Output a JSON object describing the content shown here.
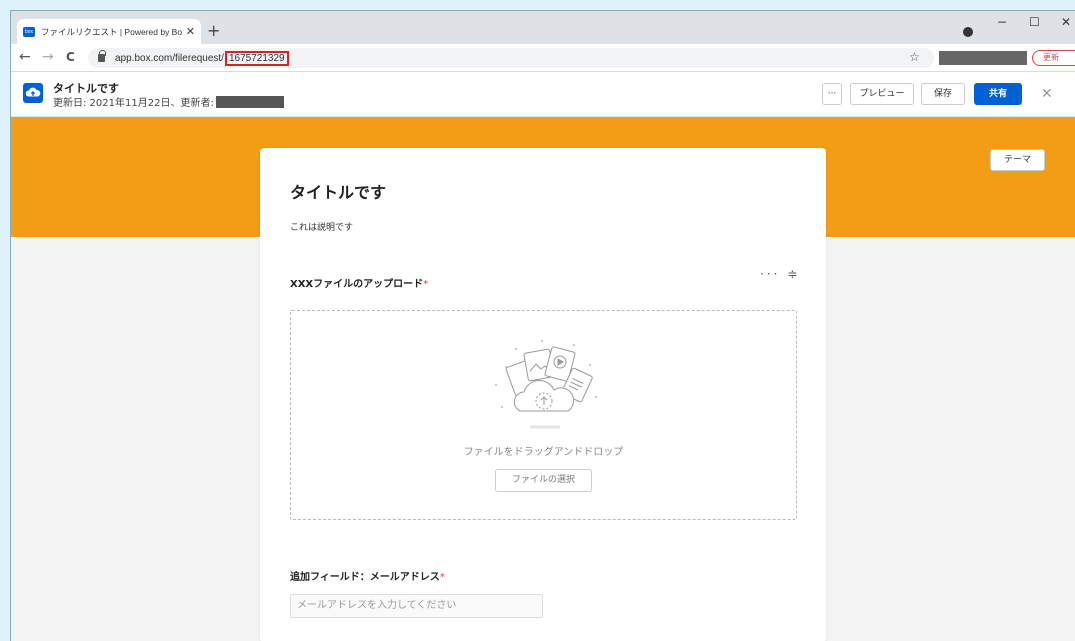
{
  "browser": {
    "tab_title": "ファイルリクエスト | Powered by Box",
    "tab_close": "✕",
    "new_tab": "+",
    "favicon_text": "box",
    "url_prefix": "app.box.com/filerequest/",
    "url_id": "1675721329",
    "update_label": "更新",
    "star": "☆",
    "min": "−",
    "max": "☐",
    "close": "✕",
    "back": "←",
    "forward": "→",
    "reload": "C"
  },
  "header": {
    "title": "タイトルです",
    "meta_prefix": "更新日: 2021年11月22日、更新者:",
    "more_label": "···",
    "preview_label": "プレビュー",
    "save_label": "保存",
    "share_label": "共有",
    "close": "✕"
  },
  "theme_label": "テーマ",
  "form": {
    "title": "タイトルです",
    "description": "これは説明です",
    "upload_field": {
      "label": "XXXファイルのアップロード",
      "required_mark": "*",
      "tools": "··· ≑",
      "drop_text": "ファイルをドラッグアンドドロップ",
      "select_label": "ファイルの選択"
    },
    "email_field": {
      "label": "追加フィールド：メールアドレス",
      "required_mark": "*",
      "placeholder": "メールアドレスを入力してください"
    }
  },
  "colors": {
    "banner": "#f29d14",
    "brand": "#0061d5",
    "highlight": "#d3232a"
  }
}
